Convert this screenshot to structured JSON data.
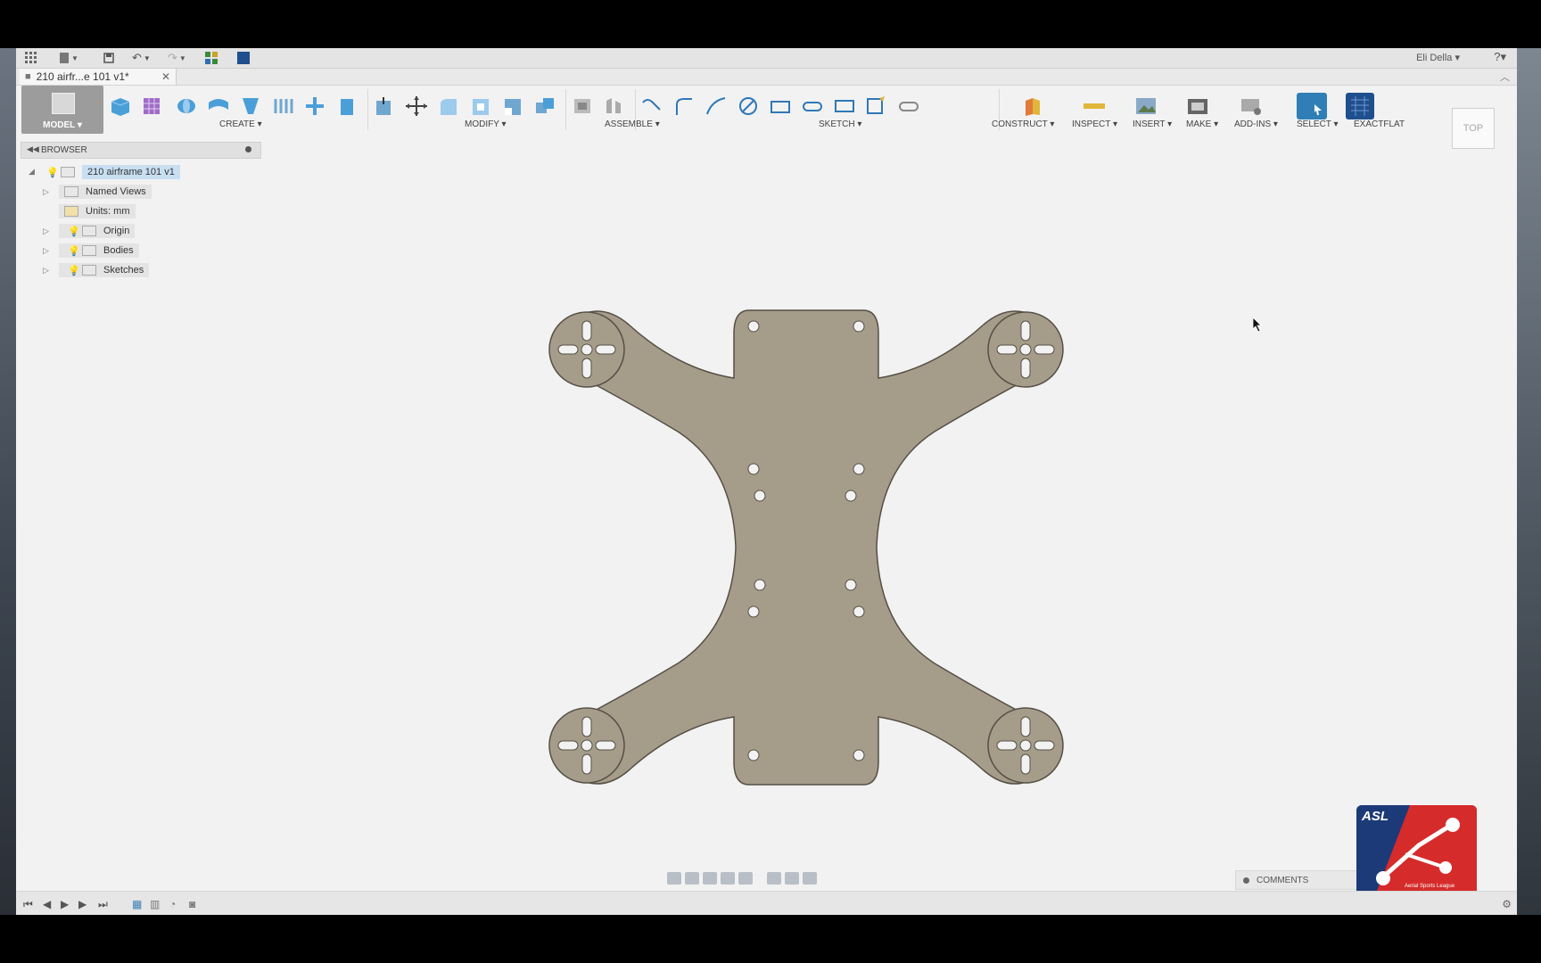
{
  "quick_access": {
    "icons": [
      "grid-icon",
      "file-icon",
      "save-icon",
      "undo-icon",
      "redo-icon",
      "data-panel-icon",
      "app-icon"
    ],
    "user": "Eli Della ▾",
    "help": "?▾"
  },
  "tab": {
    "title": "210 airfr...e 101 v1*",
    "close": "✕"
  },
  "toolbar": {
    "mode": "MODEL ▾",
    "groups": {
      "create": "CREATE ▾",
      "modify": "MODIFY ▾",
      "assemble": "ASSEMBLE ▾",
      "sketch": "SKETCH ▾",
      "construct": "CONSTRUCT ▾",
      "inspect": "INSPECT ▾",
      "insert": "INSERT ▾",
      "make": "MAKE ▾",
      "addins": "ADD-INS ▾",
      "select": "SELECT ▾",
      "exactflat": "EXACTFLAT"
    },
    "colors": {
      "create": "#4a9fd8",
      "modify": "#6fa7d0",
      "sketch": "#2f78b8",
      "construct": "#e07b3a",
      "inspect": "#e2b63a",
      "select": "#2f7fb6",
      "exactflat": "#1f4f8c"
    }
  },
  "viewcube": "TOP",
  "browser": {
    "title": "BROWSER",
    "root": "210 airframe 101 v1",
    "items": [
      {
        "label": "Named Views"
      },
      {
        "label": "Units: mm"
      },
      {
        "label": "Origin"
      },
      {
        "label": "Bodies"
      },
      {
        "label": "Sketches"
      }
    ]
  },
  "comments": "COMMENTS",
  "logo": {
    "text": "ASL",
    "subtitle": "Aerial Sports League"
  },
  "colors": {
    "part_fill": "#a69c8a",
    "part_stroke": "#555046",
    "canvas_bg": "#f2f2f2"
  }
}
